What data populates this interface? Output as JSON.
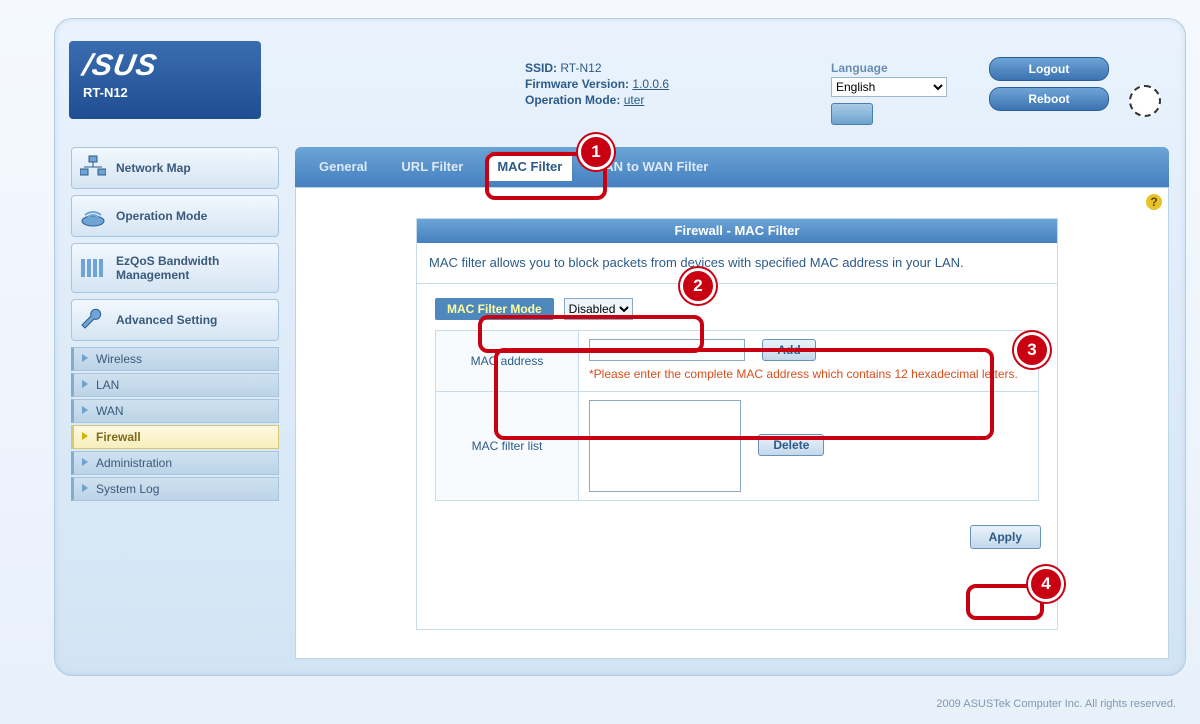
{
  "brand": "/SUS",
  "model": "RT-N12",
  "info": {
    "ssid_label": "SSID:",
    "ssid_value": "RT-N12",
    "fw_label": "Firmware Version:",
    "fw_value": "1.0.0.6",
    "opmode_label": "Operation Mode:",
    "opmode_value": "uter"
  },
  "language": {
    "label": "Language",
    "value": "English"
  },
  "top_buttons": {
    "logout": "Logout",
    "reboot": "Reboot"
  },
  "sidebar": {
    "big": [
      {
        "label": "Network Map"
      },
      {
        "label": "Operation Mode"
      },
      {
        "label": "EzQoS Bandwidth Management"
      },
      {
        "label": "Advanced Setting"
      }
    ],
    "sub": [
      {
        "label": "Wireless"
      },
      {
        "label": "LAN"
      },
      {
        "label": "WAN"
      },
      {
        "label": "Firewall",
        "active": true
      },
      {
        "label": "Administration"
      },
      {
        "label": "System Log"
      }
    ]
  },
  "tabs": {
    "general": "General",
    "url": "URL Filter",
    "mac": "MAC Filter",
    "lan": "LAN to WAN Filter",
    "active": "mac"
  },
  "panel": {
    "title": "Firewall - MAC Filter",
    "desc": "MAC filter allows you to block packets from devices with specified MAC address in your LAN.",
    "mode_label": "MAC Filter Mode",
    "mode_value": "Disabled",
    "mac_label": "MAC address",
    "mac_warn": "*Please enter the complete MAC address which contains 12 hexadecimal letters.",
    "list_label": "MAC filter list",
    "add": "Add",
    "delete": "Delete",
    "apply": "Apply"
  },
  "callouts": {
    "1": "1",
    "2": "2",
    "3": "3",
    "4": "4"
  },
  "footer": "2009 ASUSTek Computer Inc. All rights reserved."
}
